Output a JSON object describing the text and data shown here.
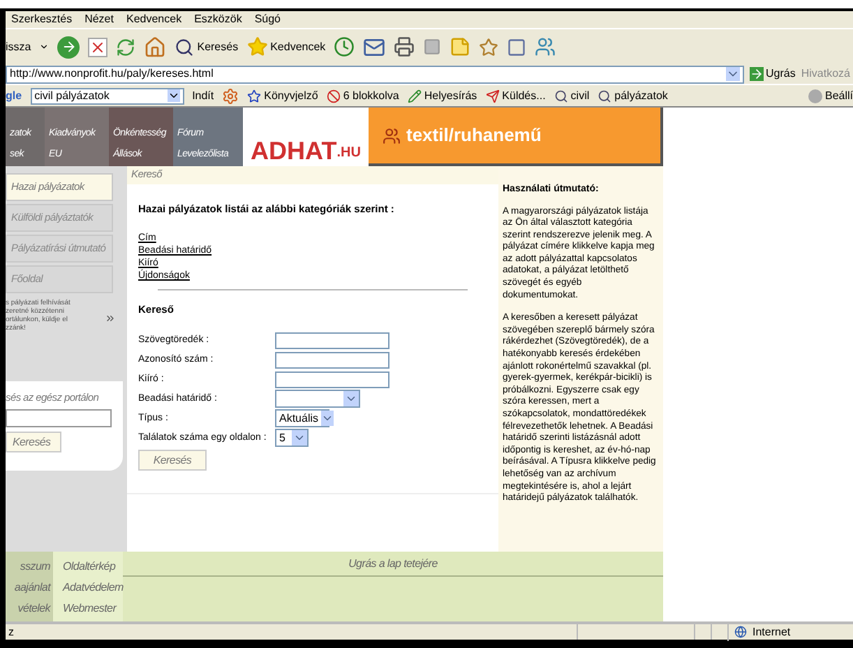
{
  "menu_bar": [
    "Szerkesztés",
    "Nézet",
    "Kedvencek",
    "Eszközök",
    "Súgó"
  ],
  "toolbar": {
    "back": "issza",
    "search": "Keresés",
    "favorites": "Kedvencek"
  },
  "address_bar": {
    "url": "http://www.nonprofit.hu/paly/kereses.html",
    "go": "Ugrás",
    "links": "Hivatkozá"
  },
  "google_bar": {
    "logo": "gle",
    "query": "civil pályázatok",
    "search": "Indít",
    "bookmarks": "Könyvjelző",
    "blocked": "6 blokkolva",
    "spell": "Helyesírás",
    "send": "Küldés...",
    "terms": [
      "civil",
      "pályázatok"
    ],
    "settings": "Beállí"
  },
  "site_nav": {
    "columns": [
      [
        "zatok",
        "sek"
      ],
      [
        "Kiadványok",
        "EU"
      ],
      [
        "Önkéntesség",
        "Állások"
      ],
      [
        "Fórum",
        "Levelezőlista"
      ]
    ],
    "logo": "ADHAT",
    "logo_suffix": ".HU",
    "banner": "textil/ruhanemű"
  },
  "sidebar": {
    "items": [
      {
        "label": "Hazai pályázatok",
        "selected": true
      },
      {
        "label": "Külföldi pályáztatók",
        "selected": false
      },
      {
        "label": "Pályázatírási útmutató",
        "selected": false
      },
      {
        "label": "Főoldal",
        "selected": false
      }
    ],
    "notice": "s pályázati felhívását zeretné közzétenni ortálunkon, küldje el zzánk!",
    "site_search": {
      "label": "sés az egész portálon",
      "button": "Keresés"
    }
  },
  "main": {
    "breadcrumb": "Kereső",
    "heading": "Hazai pályázatok listái az alábbi kategóriák szerint :",
    "links": [
      "Cím",
      "Beadási határidő",
      "Kiíró",
      "Újdonságok"
    ],
    "search_title": "Kereső",
    "fields": [
      {
        "kind": "text",
        "label": "Szövegtöredék :"
      },
      {
        "kind": "text",
        "label": "Azonosító szám :"
      },
      {
        "kind": "text",
        "label": "Kiíró :"
      },
      {
        "kind": "select",
        "label": "Beadási határidő :"
      },
      {
        "kind": "select",
        "label": "Típus :",
        "value": "Aktuális"
      },
      {
        "kind": "select",
        "label": "Találatok száma egy oldalon :",
        "value": "5"
      }
    ],
    "button": "Keresés"
  },
  "help": {
    "title": "Használati útmutató:",
    "paragraphs": [
      "A magyarországi pályázatok listája az Ön által választott kategória szerint rendszerezve jelenik meg. A pályázat címére klikkelve kapja meg az adott pályázattal kapcsolatos adatokat, a pályázat letölthető szövegét és egyéb dokumentumokat.",
      "A keresőben a keresett pályázat szövegében szereplő bármely szóra rákérdezhet (Szövegtöredék), de a hatékonyabb keresés érdekében ajánlott rokonértelmű szavakkal (pl. gyerek-gyermek, kerékpár-bicikli) is próbálkozni. Egyszerre csak egy szóra keressen, mert a szókapcsolatok, mondattöredékek félrevezethetők lehetnek. A Beadási határidő szerinti listázásnál adott időpontig is kereshet, az év-hó-nap beírásával. A Típusra klikkelve pedig lehetőség van az archívum megtekintésére is, ahol a lejárt határidejű pályázatok találhatók."
    ]
  },
  "footer": {
    "col1": [
      "sszum",
      "aajánlat",
      "vételek"
    ],
    "col2": [
      "Oldaltérkép",
      "Adatvédelem",
      "Webmester"
    ],
    "top_link": "Ugrás a lap tetejére"
  },
  "status_bar": {
    "text": "z",
    "zone": "Internet"
  }
}
